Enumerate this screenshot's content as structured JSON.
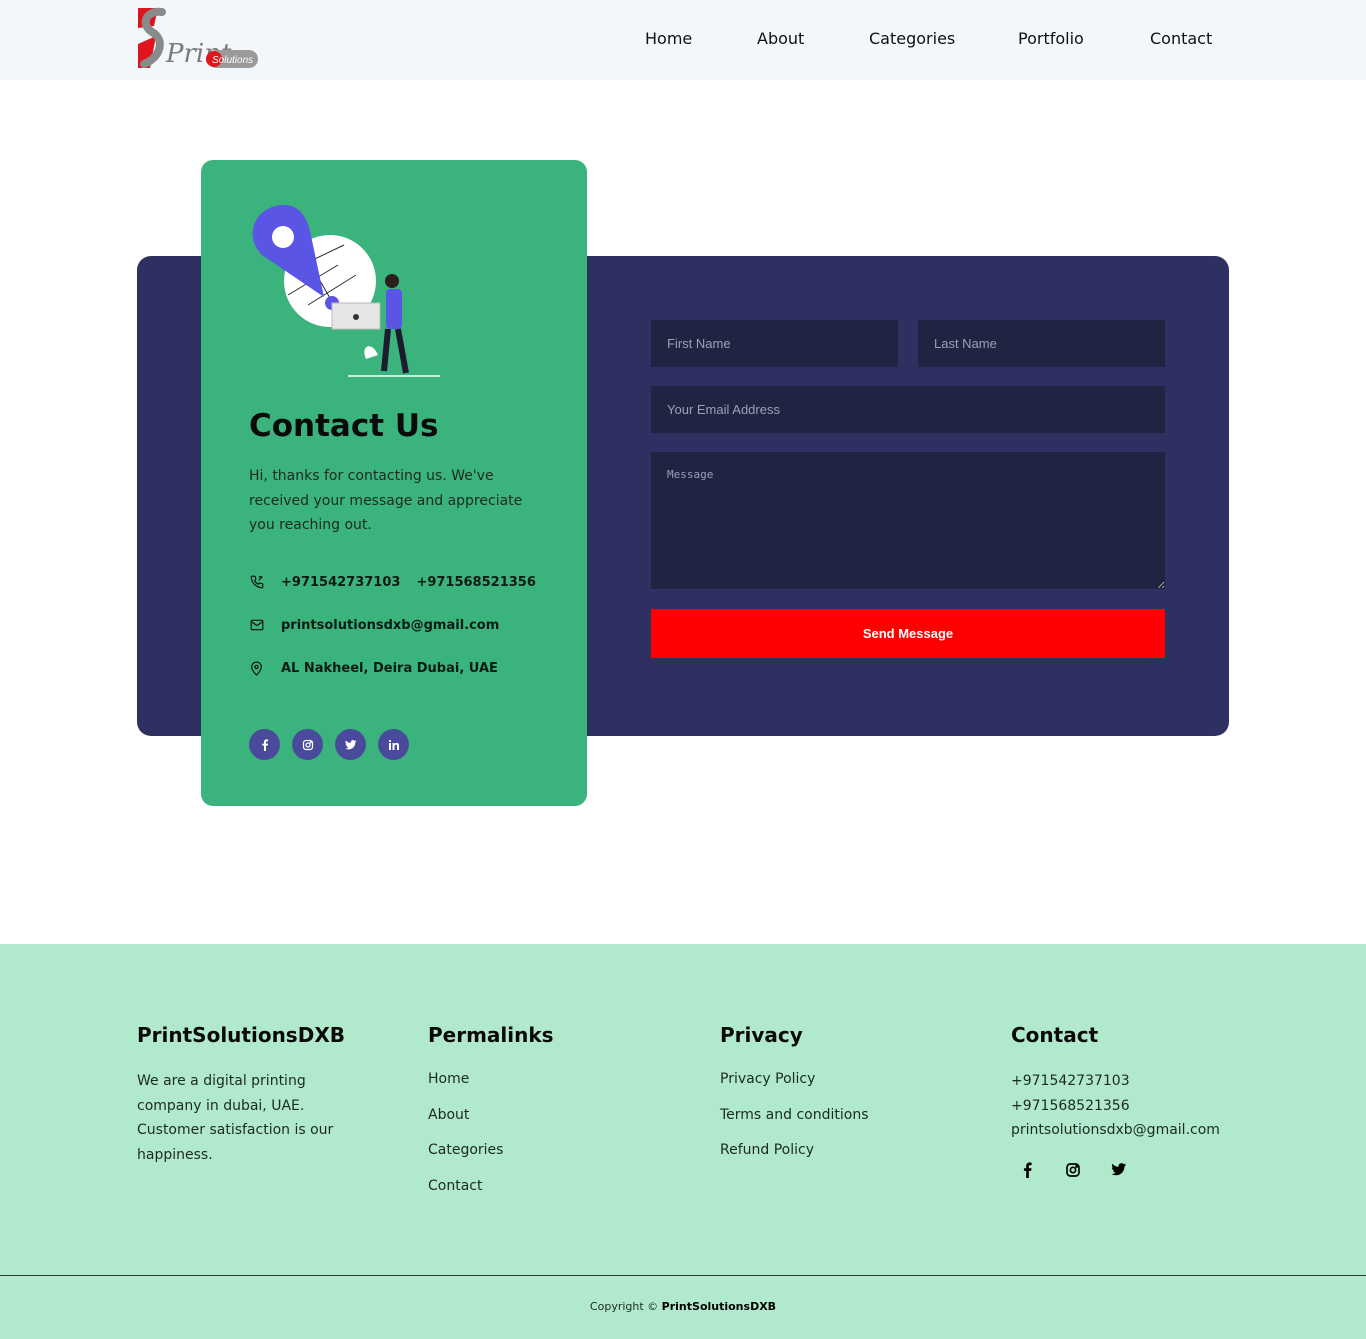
{
  "header": {
    "logo_text": "Print",
    "logo_badge": "Solutions",
    "nav": [
      "Home",
      "About",
      "Categories",
      "Portfolio",
      "Contact"
    ]
  },
  "contact_card": {
    "title": "Contact Us",
    "text": "Hi, thanks for contacting us. We've received your message and appreciate you reaching out.",
    "phone1": "+971542737103",
    "phone2": "+971568521356",
    "email": "printsolutionsdxb@gmail.com",
    "address": "AL Nakheel, Deira Dubai, UAE",
    "social": [
      "facebook-icon",
      "instagram-icon",
      "twitter-icon",
      "linkedin-icon"
    ]
  },
  "form": {
    "first_name_placeholder": "First Name",
    "last_name_placeholder": "Last Name",
    "email_placeholder": "Your Email Address",
    "message_placeholder": "Message",
    "submit_label": "Send Message"
  },
  "footer": {
    "brand_heading": "PrintSolutionsDXB",
    "brand_text": "We are a digital printing company in dubai, UAE. Customer satisfaction is our happiness.",
    "permalinks_heading": "Permalinks",
    "permalinks": [
      "Home",
      "About",
      "Categories",
      "Contact"
    ],
    "privacy_heading": "Privacy",
    "privacy_links": [
      "Privacy Policy",
      "Terms and conditions",
      "Refund Policy"
    ],
    "contact_heading": "Contact",
    "contact_phone1": "+971542737103",
    "contact_phone2": "+971568521356",
    "contact_email": "printsolutionsdxb@gmail.com",
    "copyright_prefix": "Copyright ©",
    "copyright_brand": "PrintSolutionsDXB"
  },
  "colors": {
    "header_bg": "#f2f7fb",
    "panel_dark": "#2f3062",
    "card_green": "#3bb37c",
    "field_bg": "#1f2442",
    "button_red": "#ff0000",
    "footer_bg": "#b1e9cc",
    "social_purple": "#4a4a9c"
  }
}
